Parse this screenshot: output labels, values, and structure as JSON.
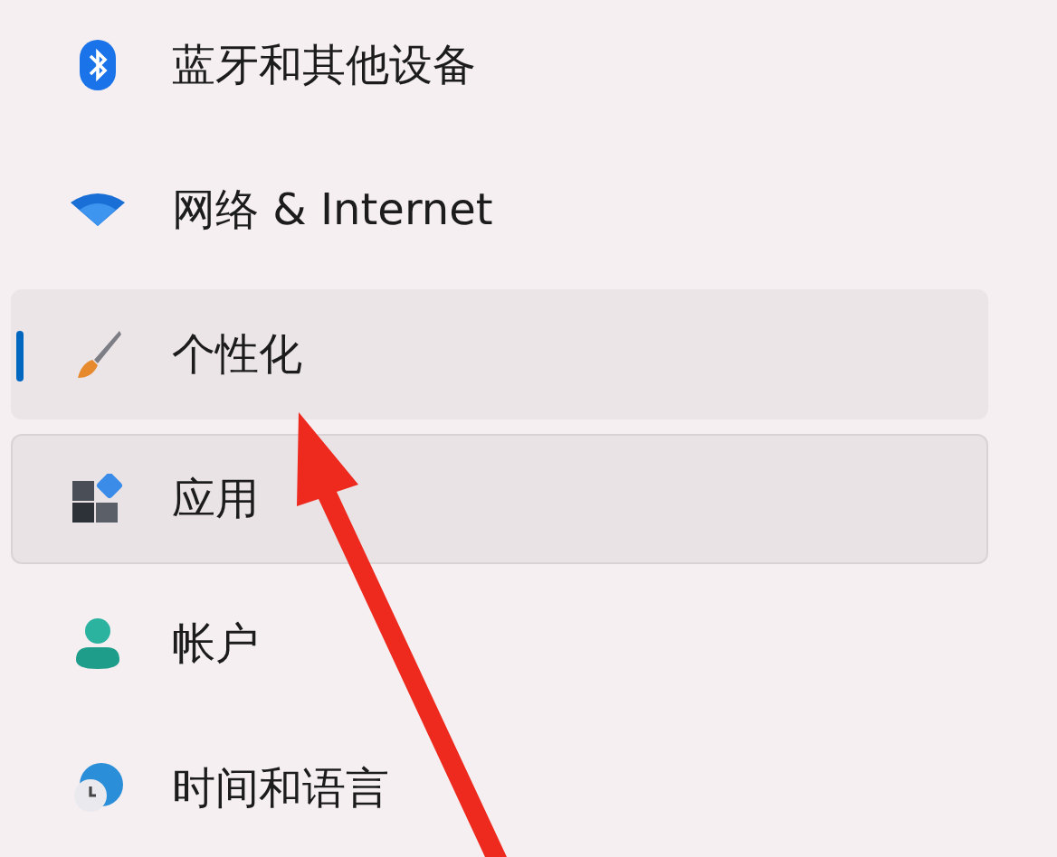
{
  "sidebar": {
    "items": [
      {
        "kind": "bluetooth",
        "label": "蓝牙和其他设备",
        "selected": false,
        "hovered": false
      },
      {
        "kind": "network",
        "label": "网络 & Internet",
        "selected": false,
        "hovered": false
      },
      {
        "kind": "personalization",
        "label": "个性化",
        "selected": true,
        "hovered": false
      },
      {
        "kind": "apps",
        "label": "应用",
        "selected": false,
        "hovered": true
      },
      {
        "kind": "accounts",
        "label": "帐户",
        "selected": false,
        "hovered": false
      },
      {
        "kind": "time",
        "label": "时间和语言",
        "selected": false,
        "hovered": false
      }
    ]
  }
}
